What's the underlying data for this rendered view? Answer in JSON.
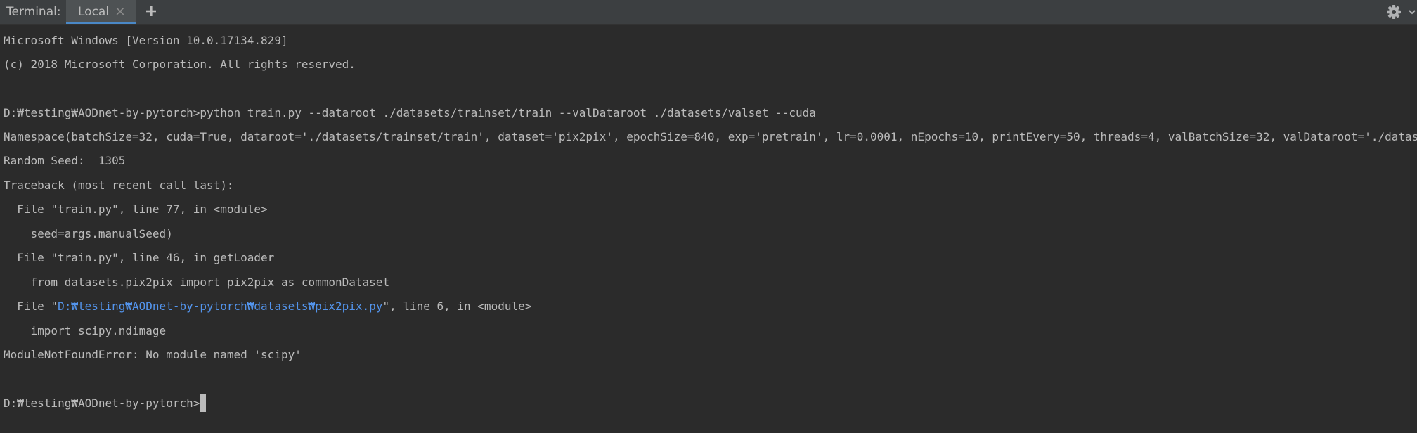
{
  "toolbar": {
    "title": "Terminal:",
    "tab_label": "Local",
    "tab_close_glyph": "×",
    "add_icon": "plus-icon",
    "settings_icon": "gear-icon",
    "more_icon": "more-icon"
  },
  "terminal": {
    "lines": [
      "Microsoft Windows [Version 10.0.17134.829]",
      "(c) 2018 Microsoft Corporation. All rights reserved.",
      "",
      "D:₩testing₩AODnet-by-pytorch>python train.py --dataroot ./datasets/trainset/train --valDataroot ./datasets/valset --cuda",
      "Namespace(batchSize=32, cuda=True, dataroot='./datasets/trainset/train', dataset='pix2pix', epochSize=840, exp='pretrain', lr=0.0001, nEpochs=10, printEvery=50, threads=4, valBatchSize=32, valDataroot='./datasets/valset')",
      "Random Seed:  1305",
      "Traceback (most recent call last):",
      "  File \"train.py\", line 77, in <module>",
      "    seed=args.manualSeed)",
      "  File \"train.py\", line 46, in getLoader",
      "    from datasets.pix2pix import pix2pix as commonDataset"
    ],
    "file_line": {
      "prefix": "  File \"",
      "link": "D:₩testing₩AODnet-by-pytorch₩datasets₩pix2pix.py",
      "suffix": "\", line 6, in <module>"
    },
    "lines_after": [
      "    import scipy.ndimage",
      "ModuleNotFoundError: No module named 'scipy'",
      ""
    ],
    "prompt": "D:₩testing₩AODnet-by-pytorch>"
  },
  "colors": {
    "background": "#2b2b2b",
    "toolbar": "#3c3f41",
    "text": "#bbbbbb",
    "link": "#5394ec",
    "tab_underline": "#4a88c7"
  }
}
